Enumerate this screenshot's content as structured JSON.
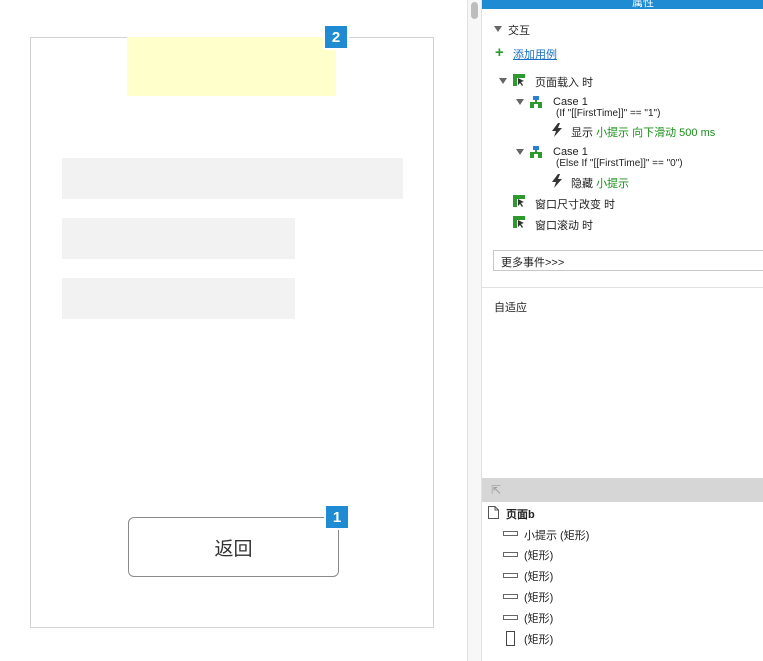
{
  "canvas": {
    "back_button_label": "返回",
    "marker_1": "1",
    "marker_2": "2"
  },
  "panel": {
    "header_title": "属性",
    "interaction_section": "交互",
    "add_case_link": "添加用例",
    "events": {
      "page_load": {
        "label": "页面载入 时"
      },
      "case1": {
        "title": "Case 1",
        "condition": "(If \"[[FirstTime]]\" == \"1\")"
      },
      "case1_action": {
        "verb": "显示",
        "detail": "小提示 向下滑动 500 ms"
      },
      "case2": {
        "title": "Case 1",
        "condition": "(Else If \"[[FirstTime]]\" == \"0\")"
      },
      "case2_action": {
        "verb": "隐藏",
        "detail": "小提示"
      },
      "window_resize": "窗口尺寸改变 时",
      "window_scroll": "窗口滚动 时"
    },
    "more_events": "更多事件>>>",
    "adaptive_section": "自适应"
  },
  "outline": {
    "page_name": "页面b",
    "items": [
      "小提示 (矩形)",
      "(矩形)",
      "(矩形)",
      "(矩形)",
      "(矩形)",
      "(矩形)"
    ]
  },
  "colors": {
    "accent": "#1f8bd2",
    "note_fill": "#ffffcc",
    "placeholder_fill": "#f2f2f2",
    "action_green": "#1a8f1a"
  }
}
